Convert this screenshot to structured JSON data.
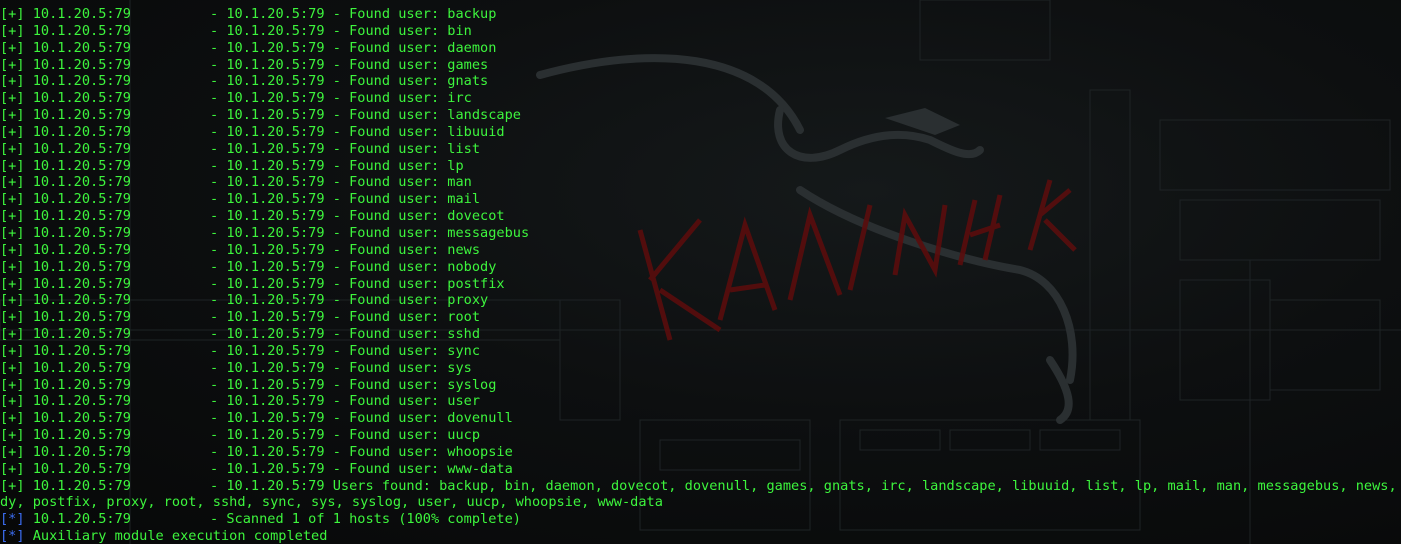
{
  "terminal": {
    "plus_prefix": "[+]",
    "star_prefix": "[*]",
    "host": "10.1.20.5:79",
    "found_lines": [
      "- 10.1.20.5:79 - Found user: backup",
      "- 10.1.20.5:79 - Found user: bin",
      "- 10.1.20.5:79 - Found user: daemon",
      "- 10.1.20.5:79 - Found user: games",
      "- 10.1.20.5:79 - Found user: gnats",
      "- 10.1.20.5:79 - Found user: irc",
      "- 10.1.20.5:79 - Found user: landscape",
      "- 10.1.20.5:79 - Found user: libuuid",
      "- 10.1.20.5:79 - Found user: list",
      "- 10.1.20.5:79 - Found user: lp",
      "- 10.1.20.5:79 - Found user: man",
      "- 10.1.20.5:79 - Found user: mail",
      "- 10.1.20.5:79 - Found user: dovecot",
      "- 10.1.20.5:79 - Found user: messagebus",
      "- 10.1.20.5:79 - Found user: news",
      "- 10.1.20.5:79 - Found user: nobody",
      "- 10.1.20.5:79 - Found user: postfix",
      "- 10.1.20.5:79 - Found user: proxy",
      "- 10.1.20.5:79 - Found user: root",
      "- 10.1.20.5:79 - Found user: sshd",
      "- 10.1.20.5:79 - Found user: sync",
      "- 10.1.20.5:79 - Found user: sys",
      "- 10.1.20.5:79 - Found user: syslog",
      "- 10.1.20.5:79 - Found user: user",
      "- 10.1.20.5:79 - Found user: dovenull",
      "- 10.1.20.5:79 - Found user: uucp",
      "- 10.1.20.5:79 - Found user: whoopsie",
      "- 10.1.20.5:79 - Found user: www-data"
    ],
    "summary_line_1": "- 10.1.20.5:79 Users found: backup, bin, daemon, dovecot, dovenull, games, gnats, irc, landscape, libuuid, list, lp, mail, man, messagebus, news, nobo",
    "summary_line_2": "dy, postfix, proxy, root, sshd, sync, sys, syslog, user, uucp, whoopsie, www-data",
    "scanned_line": "- Scanned 1 of 1 hosts (100% complete)",
    "completed_line": "Auxiliary module execution completed"
  },
  "colors": {
    "background": "#0a0c0b",
    "text_green": "#3df53d",
    "star_blue": "#3b6cf0",
    "logo_red": "#5a0d0d"
  },
  "background_art": {
    "logo_icon": "kali-dragon-icon",
    "logo_text": "KALI LINUX"
  }
}
